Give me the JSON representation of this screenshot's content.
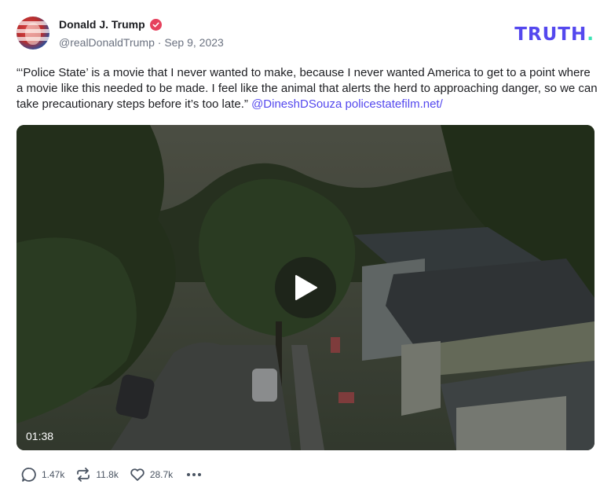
{
  "author": {
    "name": "Donald J. Trump",
    "handle": "@realDonaldTrump",
    "separator": " · ",
    "date": "Sep 9, 2023"
  },
  "brand": {
    "logo_text": "TRUTH",
    "logo_dot": ".",
    "logo_color": "#5448ee",
    "dot_color": "#3ae3b4"
  },
  "post": {
    "text": "“‘Police State’ is a movie that I never wanted to make, because I never wanted America to get to a point where a movie like this needed to be made. I feel like the animal that alerts the herd to approaching danger, so we can take precautionary steps before it’s too late.” ",
    "mention": "@DineshDSouza",
    "link": "policestatefilm.net/"
  },
  "video": {
    "duration": "01:38",
    "play_icon": "play-icon"
  },
  "actions": {
    "replies": "1.47k",
    "retruths": "11.8k",
    "likes": "28.7k"
  },
  "colors": {
    "accent": "#5448ee",
    "verified": "#e6415d"
  }
}
